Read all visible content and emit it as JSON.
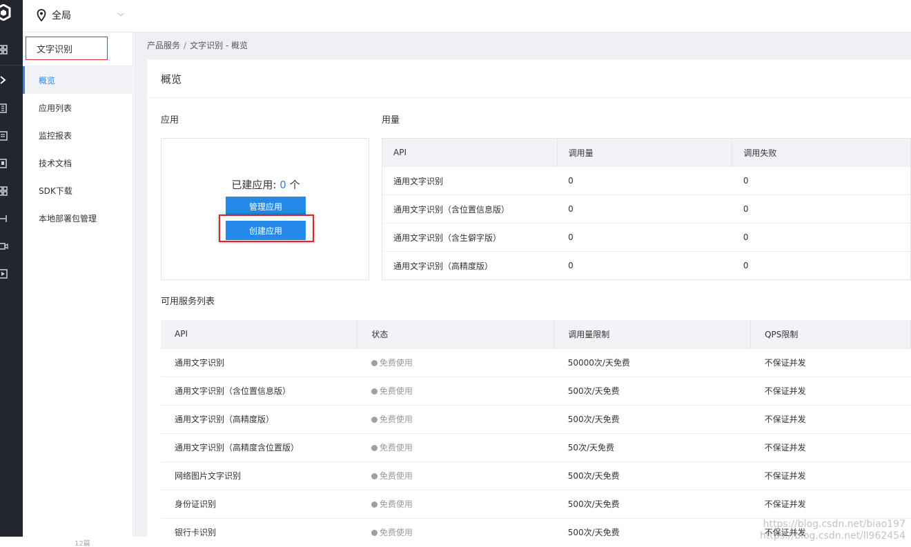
{
  "topbar": {
    "region_label": "全局"
  },
  "subnav": {
    "title": "文字识别",
    "items": [
      {
        "label": "概览"
      },
      {
        "label": "应用列表"
      },
      {
        "label": "监控报表"
      },
      {
        "label": "技术文档"
      },
      {
        "label": "SDK下载"
      },
      {
        "label": "本地部署包管理"
      }
    ]
  },
  "breadcrumb": {
    "root": "产品服务",
    "separator": "/",
    "current": "文字识别 - 概览"
  },
  "overview": {
    "title": "概览",
    "app_section_label": "应用",
    "app_count_prefix": "已建应用:",
    "app_count": "0",
    "app_count_unit": "个",
    "manage_button": "管理应用",
    "create_button": "创建应用",
    "usage_section_label": "用量",
    "usage_table": {
      "headers": [
        "API",
        "调用量",
        "调用失败"
      ],
      "rows": [
        [
          "通用文字识别",
          "0",
          "0"
        ],
        [
          "通用文字识别（含位置信息版）",
          "0",
          "0"
        ],
        [
          "通用文字识别（含生僻字版）",
          "0",
          "0"
        ],
        [
          "通用文字识别（高精度版）",
          "0",
          "0"
        ]
      ]
    },
    "service_section_label": "可用服务列表",
    "service_table": {
      "headers": [
        "API",
        "状态",
        "调用量限制",
        "QPS限制"
      ],
      "rows": [
        [
          "通用文字识别",
          "免费使用",
          "50000次/天免费",
          "不保证并发"
        ],
        [
          "通用文字识别（含位置信息版）",
          "免费使用",
          "500次/天免费",
          "不保证并发"
        ],
        [
          "通用文字识别（高精度版）",
          "免费使用",
          "500次/天免费",
          "不保证并发"
        ],
        [
          "通用文字识别（高精度含位置版）",
          "免费使用",
          "50次/天免费",
          "不保证并发"
        ],
        [
          "网络图片文字识别",
          "免费使用",
          "500次/天免费",
          "不保证并发"
        ],
        [
          "身份证识别",
          "免费使用",
          "500次/天免费",
          "不保证并发"
        ],
        [
          "银行卡识别",
          "免费使用",
          "500次/天免费",
          "不保证并发"
        ]
      ]
    }
  },
  "footer": {
    "page_info": "12篇"
  },
  "watermark": {
    "line1": "https://blog.csdn.net/biao197",
    "line2": "https://blog.csdn.net/ll962454"
  },
  "colors": {
    "accent": "#2489e8",
    "highlight": "#d8262c",
    "rail": "#23262e"
  },
  "icons": [
    "logo-icon",
    "grid-icon",
    "chevron-right-icon",
    "building-icon",
    "document-icon",
    "book-icon",
    "grid-icon",
    "network-icon",
    "video-icon",
    "play-icon",
    "location-pin-icon",
    "chevron-down-icon"
  ]
}
